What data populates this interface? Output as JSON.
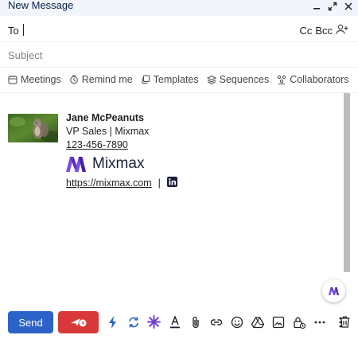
{
  "window": {
    "title": "New Message"
  },
  "to": {
    "label": "To",
    "cc_label": "Cc",
    "bcc_label": "Bcc"
  },
  "subject": {
    "placeholder": "Subject"
  },
  "toolbar": {
    "items": [
      {
        "label": "Meetings",
        "icon": "calendar-icon"
      },
      {
        "label": "Remind me",
        "icon": "alarm-clock-icon"
      },
      {
        "label": "Templates",
        "icon": "copy-icon"
      },
      {
        "label": "Sequences",
        "icon": "layers-icon"
      },
      {
        "label": "Collaborators",
        "icon": "people-icon"
      }
    ]
  },
  "signature": {
    "name": "Jane McPeanuts",
    "role": "VP Sales | Mixmax",
    "phone": "123-456-7890",
    "brand": "Mixmax",
    "website": "https://mixmax.com",
    "separator": "|"
  },
  "bottom": {
    "send_label": "Send"
  },
  "colors": {
    "send": "#2c63c8",
    "send_later": "#d9383a",
    "brand_purple": "#6b3fd4",
    "title_bar": "#f2f6fc"
  }
}
